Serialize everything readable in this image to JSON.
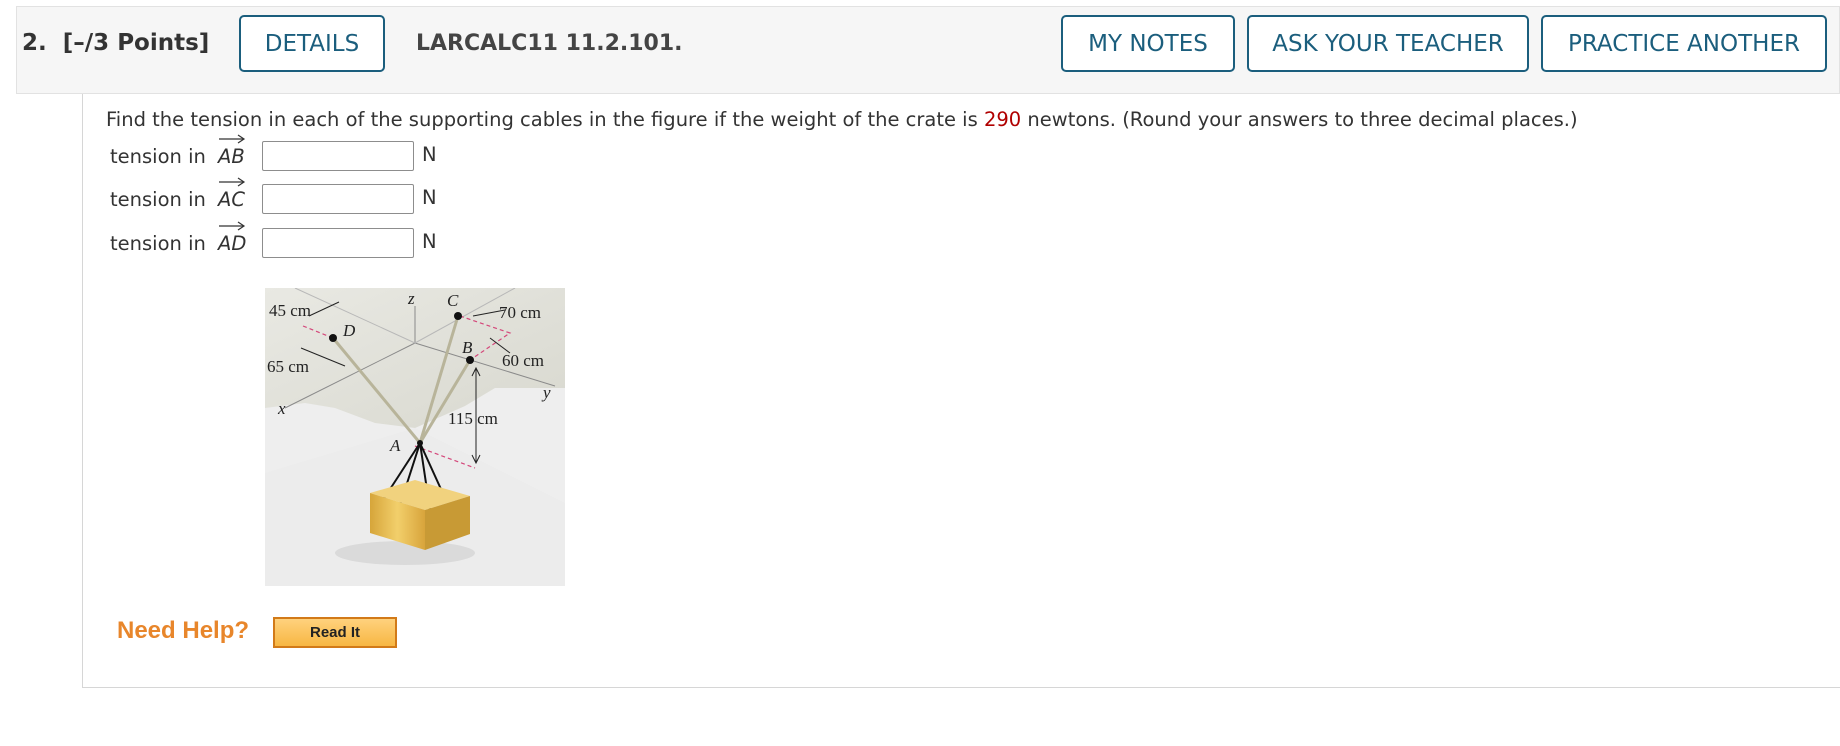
{
  "header": {
    "question_number": "2.",
    "points": "[–/3 Points]",
    "details_label": "DETAILS",
    "question_id": "LARCALC11 11.2.101.",
    "my_notes_label": "MY NOTES",
    "ask_teacher_label": "ASK YOUR TEACHER",
    "practice_label": "PRACTICE ANOTHER"
  },
  "question": {
    "prompt_before": "Find the tension in each of the supporting cables in the figure if the weight of the crate is ",
    "weight_value": "290",
    "prompt_after": " newtons. (Round your answers to three decimal places.)",
    "rows": [
      {
        "label": "tension in",
        "vector": "AB",
        "value": "",
        "unit": "N"
      },
      {
        "label": "tension in",
        "vector": "AC",
        "value": "",
        "unit": "N"
      },
      {
        "label": "tension in",
        "vector": "AD",
        "value": "",
        "unit": "N"
      }
    ]
  },
  "figure": {
    "labels": {
      "d45": "45 cm",
      "d70": "70 cm",
      "d65": "65 cm",
      "d60": "60 cm",
      "d115": "115 cm",
      "C": "C",
      "D": "D",
      "B": "B",
      "A": "A",
      "x": "x",
      "y": "y",
      "z": "z"
    }
  },
  "help": {
    "need_help": "Need Help?",
    "read_it_label": "Read It"
  },
  "colors": {
    "button_border": "#1b5e7d",
    "weight_red": "#b00000",
    "need_help_orange": "#e8862b"
  }
}
